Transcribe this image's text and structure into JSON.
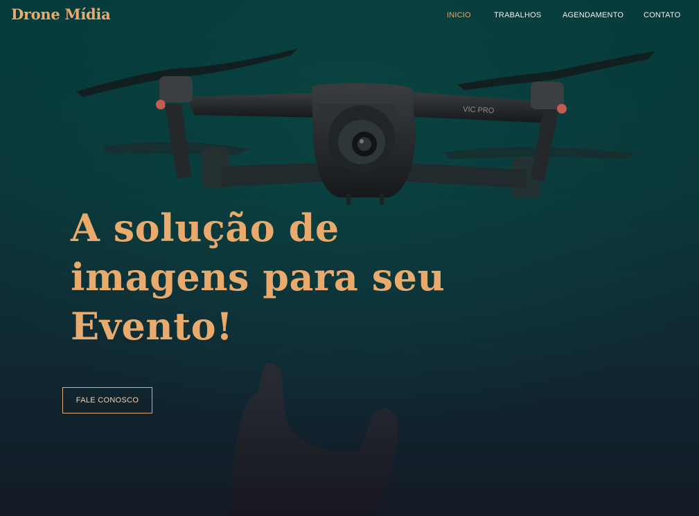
{
  "header": {
    "logo": "Drone Mídia"
  },
  "nav": {
    "items": [
      {
        "label": "INICIO",
        "active": true
      },
      {
        "label": "TRABALHOS",
        "active": false
      },
      {
        "label": "AGENDAMENTO",
        "active": false
      },
      {
        "label": "CONTATO",
        "active": false
      }
    ]
  },
  "hero": {
    "headline_lines": [
      "A solução de",
      "imagens para seu",
      "Evento!"
    ],
    "cta_label": "FALE CONOSCO",
    "drone_model_text": "VIC PRO"
  },
  "colors": {
    "accent": "#e9ab6d",
    "nav_text": "#f1f1f1",
    "background_top": "#053a3a",
    "background_bottom": "#141a26"
  }
}
